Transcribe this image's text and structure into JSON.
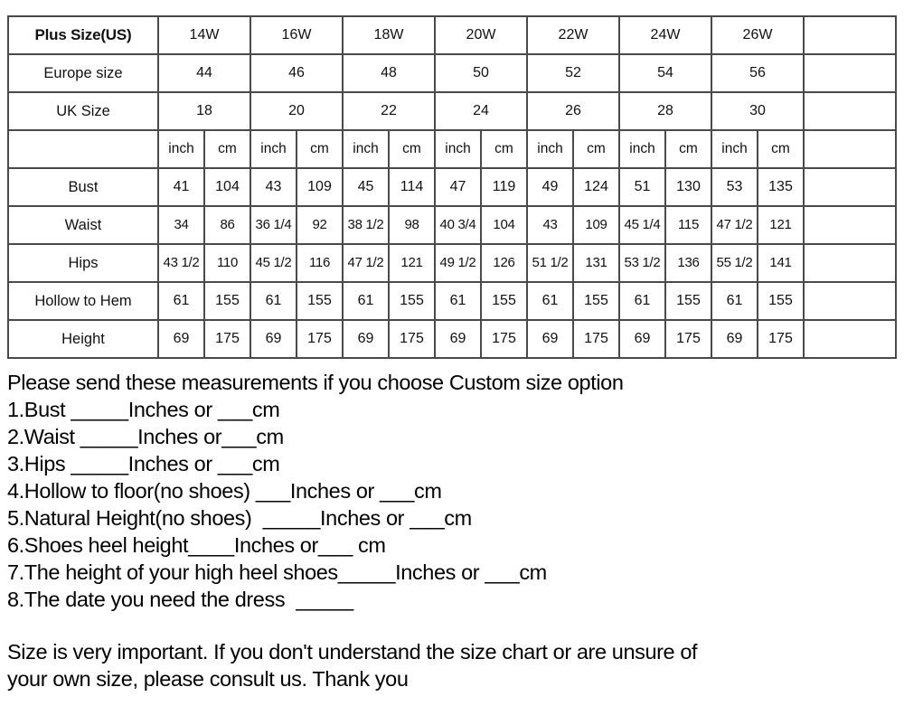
{
  "table": {
    "row_labels": [
      "Plus Size(US)",
      "Europe size",
      "UK Size",
      "",
      "Bust",
      "Waist",
      "Hips",
      "Hollow to Hem",
      "Height"
    ],
    "size_columns": [
      "14W",
      "16W",
      "18W",
      "20W",
      "22W",
      "24W",
      "26W"
    ],
    "europe_size": [
      "44",
      "46",
      "48",
      "50",
      "52",
      "54",
      "56"
    ],
    "uk_size": [
      "18",
      "20",
      "22",
      "24",
      "26",
      "28",
      "30"
    ],
    "unit_headers": [
      "inch",
      "cm",
      "inch",
      "cm",
      "inch",
      "cm",
      "inch",
      "cm",
      "inch",
      "cm",
      "inch",
      "cm",
      "inch",
      "cm"
    ],
    "measurements": [
      {
        "label": "Bust",
        "values": [
          "41",
          "104",
          "43",
          "109",
          "45",
          "114",
          "47",
          "119",
          "49",
          "124",
          "51",
          "130",
          "53",
          "135"
        ]
      },
      {
        "label": "Waist",
        "values": [
          "34",
          "86",
          "36 1/4",
          "92",
          "38 1/2",
          "98",
          "40 3/4",
          "104",
          "43",
          "109",
          "45 1/4",
          "115",
          "47 1/2",
          "121"
        ]
      },
      {
        "label": "Hips",
        "values": [
          "43 1/2",
          "110",
          "45 1/2",
          "116",
          "47 1/2",
          "121",
          "49 1/2",
          "126",
          "51 1/2",
          "131",
          "53 1/2",
          "136",
          "55 1/2",
          "141"
        ]
      },
      {
        "label": "Hollow to Hem",
        "values": [
          "61",
          "155",
          "61",
          "155",
          "61",
          "155",
          "61",
          "155",
          "61",
          "155",
          "61",
          "155",
          "61",
          "155"
        ]
      },
      {
        "label": "Height",
        "values": [
          "69",
          "175",
          "69",
          "175",
          "69",
          "175",
          "69",
          "175",
          "69",
          "175",
          "69",
          "175",
          "69",
          "175"
        ]
      }
    ]
  },
  "notes": {
    "intro": "Please send these measurements if you choose Custom size option",
    "items": [
      "1.Bust _____Inches or ___cm",
      "2.Waist _____Inches or___cm",
      "3.Hips _____Inches or ___cm",
      "4.Hollow to floor(no shoes) ___Inches or ___cm",
      "5.Natural Height(no shoes)  _____Inches or ___cm",
      "6.Shoes heel height____Inches or___ cm",
      "7.The height of your high heel shoes_____Inches or ___cm",
      "8.The date you need the dress  _____"
    ],
    "footer_line_1": "Size is very important. If you don't understand the size chart or are unsure of",
    "footer_line_2": "your own size, please consult us. Thank you"
  },
  "colors": {
    "border": "#4a4a4a",
    "text": "#000000",
    "background": "#ffffff"
  }
}
